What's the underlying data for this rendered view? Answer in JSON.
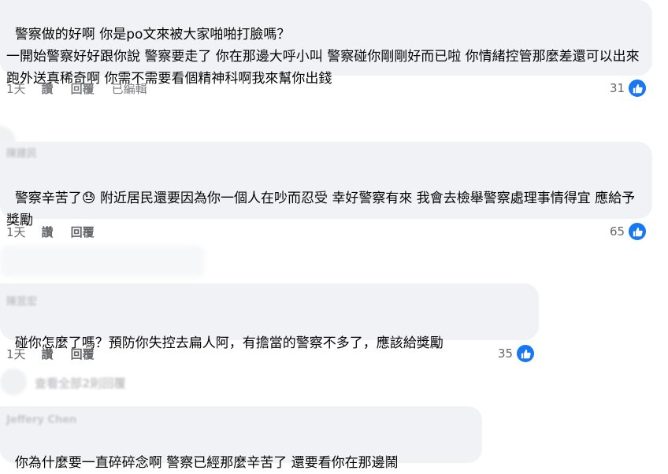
{
  "comments": [
    {
      "author": "",
      "text": "警察做的好啊 你是po文來被大家啪啪打臉嗎？\n一開始警察好好跟你說 警察要走了 你在那邊大呼小叫 警察碰你剛剛好而已啦 你情緒控管那麼差還可以出來跑外送真稀奇啊 你需不需要看個精神科啊我來幫你出錢",
      "time": "1天",
      "like_label": "讚",
      "reply_label": "回覆",
      "edited_label": "已編輯",
      "reaction_count": "31"
    },
    {
      "author": "陳建民",
      "text": "警察辛苦了😓 附近居民還要因為你一個人在吵而忍受 幸好警察有來 我會去檢舉警察處理事情得宜 應給予獎勵",
      "time": "1天",
      "like_label": "讚",
      "reply_label": "回覆",
      "reaction_count": "65"
    },
    {
      "author": "陳昱宏",
      "text": "碰你怎麼了嗎？預防你失控去扁人阿，有擔當的警察不多了，應該給獎勵",
      "time": "1天",
      "like_label": "讚",
      "reply_label": "回覆",
      "reaction_count": "35",
      "replies_label": "查看全部2則回覆"
    },
    {
      "author": "Jeffery Chen",
      "text": "你為什麼要一直碎碎念啊 警察已經那麼辛苦了 還要看你在那邊鬧"
    }
  ],
  "colors": {
    "bubble": "#f0f2f5",
    "like": "#1877f2",
    "meta": "#65676b"
  },
  "icons": {
    "reaction": "thumbs-up-icon"
  }
}
